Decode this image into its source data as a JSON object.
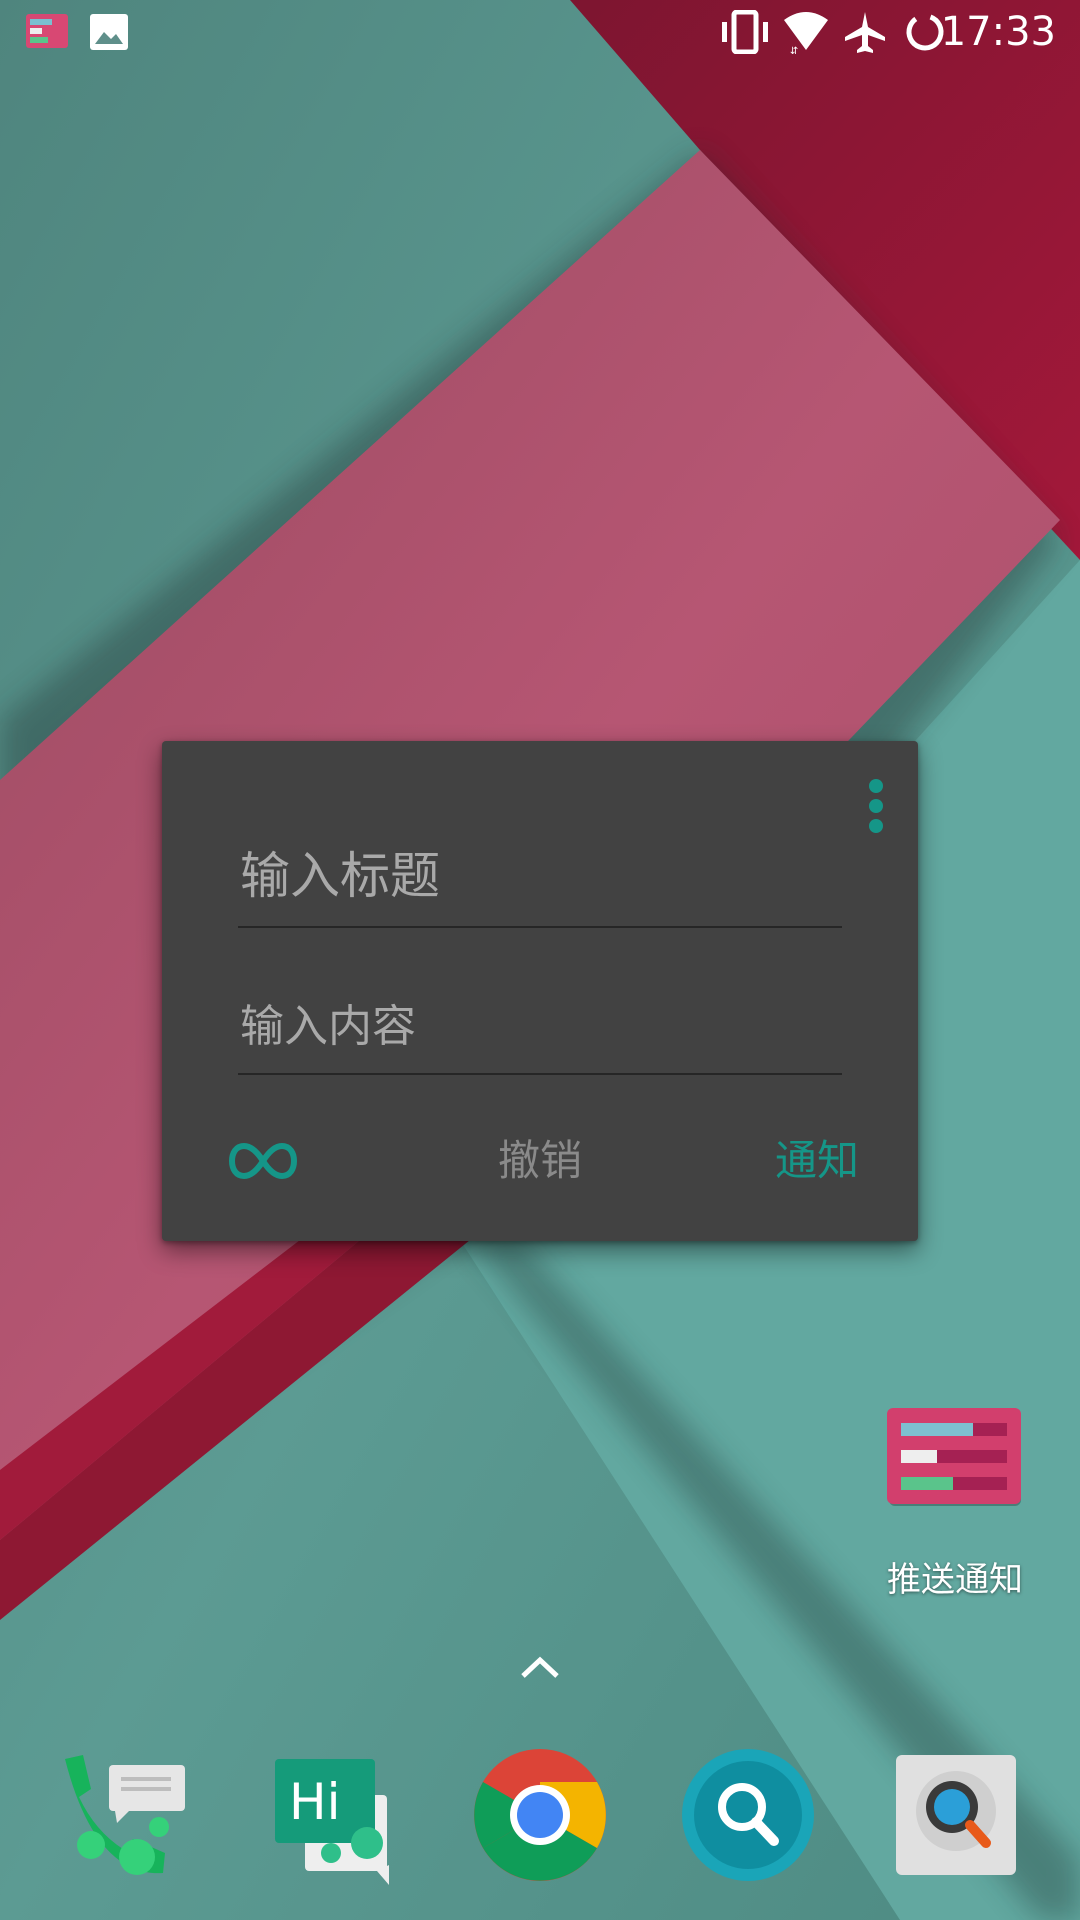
{
  "status_bar": {
    "time": "17:33",
    "left_icons": [
      "notification-app-icon",
      "image-icon"
    ],
    "right_icons": [
      "vibrate-icon",
      "wifi-icon",
      "airplane-mode-icon",
      "loading-icon"
    ]
  },
  "widget": {
    "title_placeholder": "输入标题",
    "content_placeholder": "输入内容",
    "loop_icon": "infinity-icon",
    "undo_label": "撤销",
    "notify_label": "通知",
    "menu_icon": "more-vert-icon"
  },
  "home": {
    "push_app_label": "推送通知",
    "push_app_icon": "push-notification-app-icon",
    "drawer_icon": "chevron-up-icon"
  },
  "dock": {
    "apps": [
      "phone-messages-app-icon",
      "hangouts-app-icon",
      "chrome-app-icon",
      "search-app-icon",
      "magnifier-app-icon"
    ]
  },
  "colors": {
    "accent": "#159688",
    "widget_bg": "#424242",
    "wallpaper_teal": "#5f9d96",
    "wallpaper_pink": "#a84f67",
    "wallpaper_crimson": "#8a1630"
  }
}
